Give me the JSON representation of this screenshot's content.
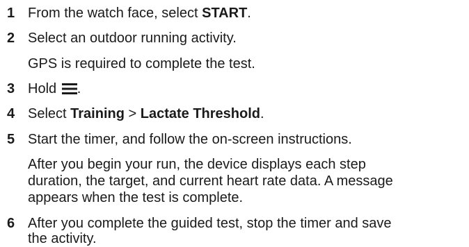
{
  "steps": [
    {
      "number": "1",
      "pre": "From the watch face, select ",
      "bold": "START",
      "post": "."
    },
    {
      "number": "2",
      "text": "Select an outdoor running activity."
    },
    {
      "number": "3",
      "pre": "Hold ",
      "icon": "menu-icon",
      "post": "."
    },
    {
      "number": "4",
      "pre": "Select ",
      "bold1": "Training",
      "mid": " > ",
      "bold2": "Lactate Threshold",
      "post": "."
    },
    {
      "number": "5",
      "text": "Start the timer, and follow the on-screen instructions."
    },
    {
      "number": "6",
      "line1": "After you complete the guided test, stop the timer and save",
      "line2": "the activity."
    }
  ],
  "notes": {
    "gps": "GPS is required to complete the test.",
    "run_line1": "After you begin your run, the device displays each step",
    "run_line2": "duration, the target, and current heart rate data. A message",
    "run_line3": "appears when the test is complete."
  }
}
